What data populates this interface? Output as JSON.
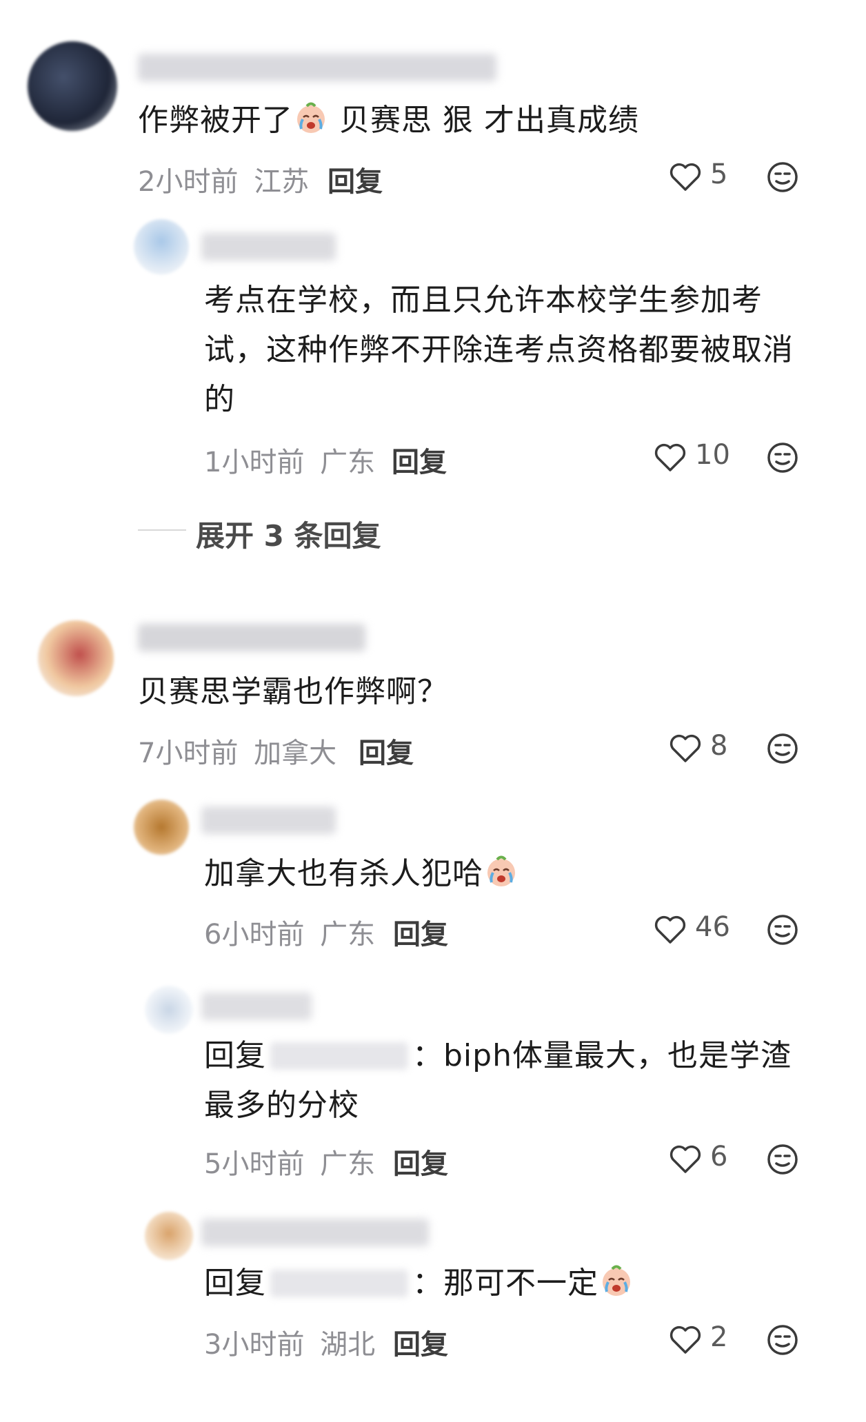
{
  "comments": [
    {
      "text": "作弊被开了",
      "text_after_emoji": " 贝赛思 狠 才出真成绩",
      "time": "2小时前",
      "location": "江苏",
      "reply_label": "回复",
      "likes": "5"
    },
    {
      "text": "考点在学校，而且只允许本校学生参加考试，这种作弊不开除连考点资格都要被取消的",
      "time": "1小时前",
      "location": "广东",
      "reply_label": "回复",
      "likes": "10"
    },
    {
      "text": "贝赛思学霸也作弊啊？",
      "time": "7小时前",
      "location": "加拿大",
      "reply_label": "回复",
      "likes": "8"
    },
    {
      "text": "加拿大也有杀人犯哈",
      "time": "6小时前",
      "location": "广东",
      "reply_label": "回复",
      "likes": "46"
    },
    {
      "prefix": "回复",
      "text": "：biph体量最大，也是学渣最多的分校",
      "time": "5小时前",
      "location": "广东",
      "reply_label": "回复",
      "likes": "6"
    },
    {
      "prefix": "回复",
      "text": "：那可不一定",
      "time": "3小时前",
      "location": "湖北",
      "reply_label": "回复",
      "likes": "2"
    }
  ],
  "expand": {
    "label": "展开 3 条回复"
  },
  "icons": {
    "like": "heart-outline-icon",
    "dislike": "neutral-face-icon",
    "emoji": "crying-face-emoji"
  },
  "colors": {
    "meta": "#8e8e93",
    "text": "#1c1c1c",
    "icon": "#3a3a3a"
  }
}
